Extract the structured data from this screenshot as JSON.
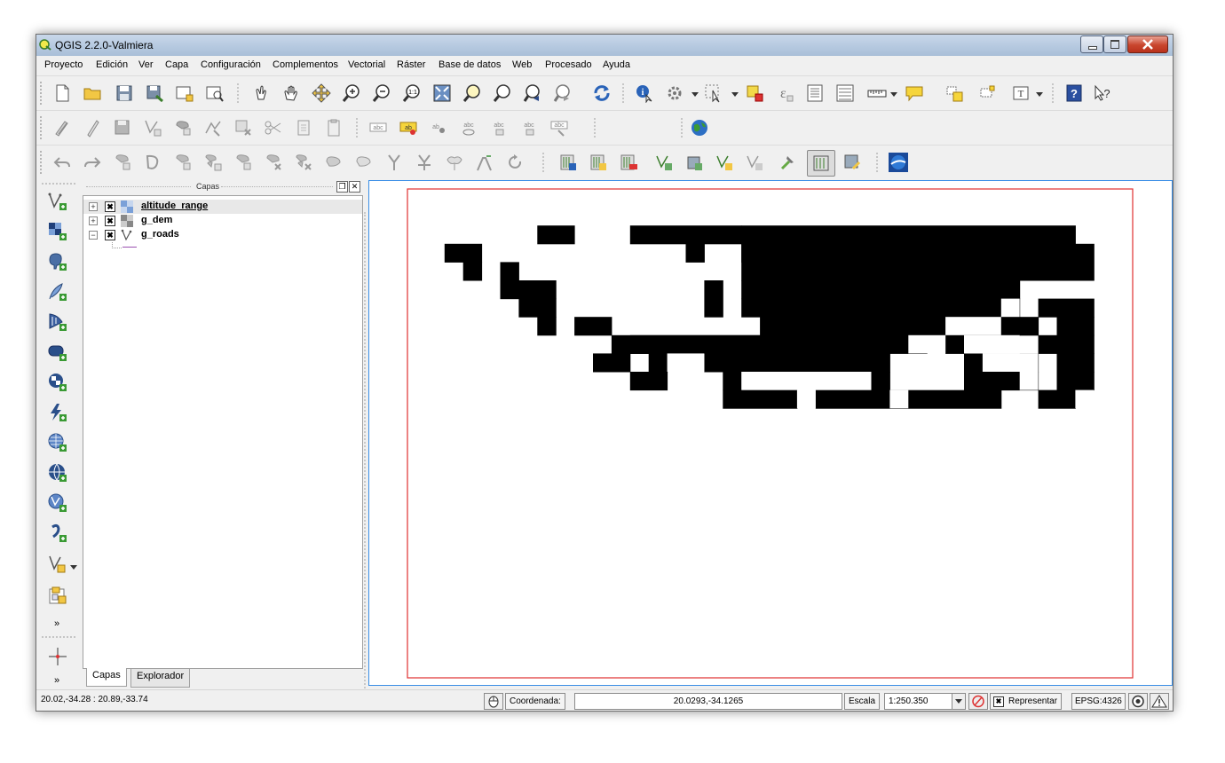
{
  "window": {
    "title": "QGIS 2.2.0-Valmiera",
    "controls": [
      "minimize",
      "maximize",
      "close"
    ]
  },
  "menu": {
    "items": [
      "Proyecto",
      "Edición",
      "Ver",
      "Capa",
      "Configuración",
      "Complementos",
      "Vectorial",
      "Ráster",
      "Base de datos",
      "Web",
      "Procesado",
      "Ayuda"
    ]
  },
  "layers_panel": {
    "title": "Capas",
    "layers": [
      {
        "name": "altitude_range",
        "checked": true,
        "expanded": false,
        "type": "raster",
        "selected": true
      },
      {
        "name": "g_dem",
        "checked": true,
        "expanded": false,
        "type": "raster",
        "selected": false
      },
      {
        "name": "g_roads",
        "checked": true,
        "expanded": true,
        "type": "vector-line",
        "selected": false
      }
    ],
    "tabs": [
      "Capas",
      "Explorador"
    ],
    "active_tab": "Capas"
  },
  "canvas": {
    "frame_color": "#e03030",
    "raster_color": "#000000"
  },
  "statusbar": {
    "extent": "20.02,-34.28 : 20.89,-33.74",
    "coord_label": "Coordenada:",
    "coord_value": "20.0293,-34.1265",
    "scale_label": "Escala",
    "scale_value": "1:250.350",
    "render_label": "Representar",
    "render_checked": true,
    "crs": "EPSG:4326"
  },
  "colors": {
    "title_bar": "#b8cbe2",
    "toolbar_bg": "#f0f0f0",
    "canvas_border": "#3a8ee6",
    "close_button": "#c9452d"
  }
}
